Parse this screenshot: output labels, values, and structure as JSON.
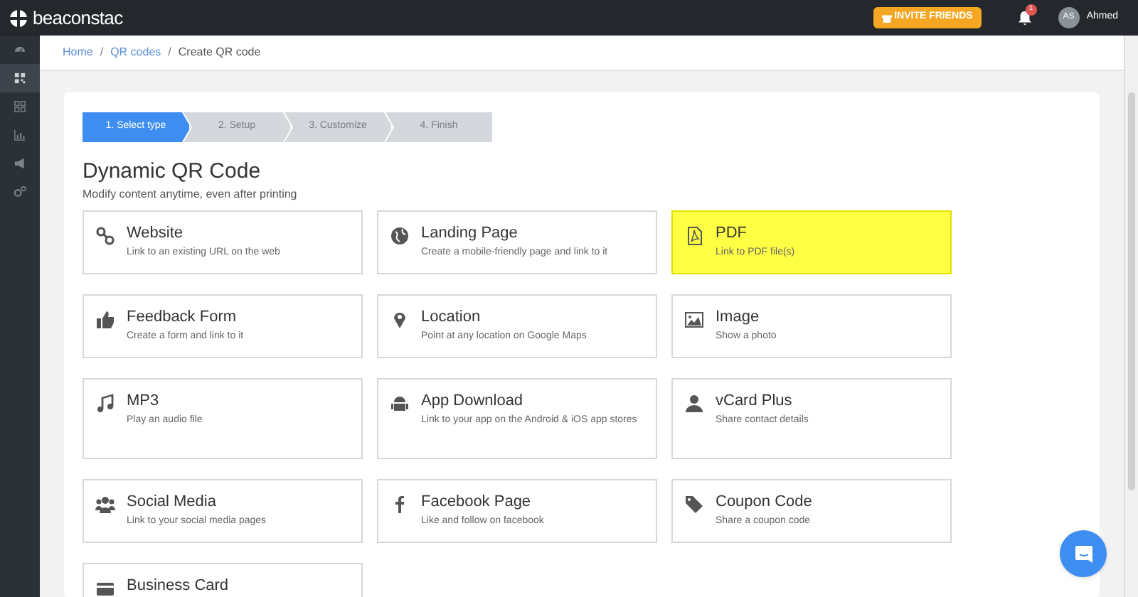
{
  "topbar": {
    "logo": "beaconstac",
    "invite_button": "INVITE FRIENDS",
    "notification_count": "1",
    "avatar_initials": "AS",
    "user_name": "Ahmed"
  },
  "sidebar": {
    "items": [
      {
        "selected": false
      },
      {
        "selected": true
      },
      {
        "selected": false
      },
      {
        "selected": false
      },
      {
        "selected": false
      },
      {
        "selected": false
      }
    ]
  },
  "breadcrumb": [
    {
      "label": "Home",
      "kind": "link"
    },
    {
      "label": "/",
      "kind": "separator"
    },
    {
      "label": "QR codes",
      "kind": "link"
    },
    {
      "label": "/",
      "kind": "separator"
    },
    {
      "label": "Create QR code",
      "kind": "current"
    }
  ],
  "steps": [
    {
      "label": "1. Select type",
      "selected": true
    },
    {
      "label": "2. Setup",
      "selected": false
    },
    {
      "label": "3. Customize",
      "selected": false
    },
    {
      "label": "4. Finish",
      "selected": false
    }
  ],
  "heading": "Dynamic QR Code",
  "subheading": "Modify content anytime, even after printing",
  "types": [
    {
      "title": "Website",
      "description": "Link to an existing URL on the web",
      "highlighted": false
    },
    {
      "title": "Landing Page",
      "description": "Create a mobile-friendly page and link to it",
      "highlighted": false
    },
    {
      "title": "PDF",
      "description": "Link to PDF file(s)",
      "highlighted": true
    },
    {
      "title": "Feedback Form",
      "description": "Create a form and link to it",
      "highlighted": false
    },
    {
      "title": "Location",
      "description": "Point at any location on Google Maps",
      "highlighted": false
    },
    {
      "title": "Image",
      "description": "Show a photo",
      "highlighted": false
    },
    {
      "title": "MP3",
      "description": "Play an audio file",
      "highlighted": false
    },
    {
      "title": "App Download",
      "description": "Link to your app on the Android & iOS app stores",
      "highlighted": false
    },
    {
      "title": "vCard Plus",
      "description": "Share contact details",
      "highlighted": false
    },
    {
      "title": "Social Media",
      "description": "Link to your social media pages",
      "highlighted": false
    },
    {
      "title": "Facebook Page",
      "description": "Like and follow on facebook",
      "highlighted": false
    },
    {
      "title": "Coupon Code",
      "description": "Share a coupon code",
      "highlighted": false
    },
    {
      "title": "Business Card",
      "highlighted": false
    }
  ]
}
